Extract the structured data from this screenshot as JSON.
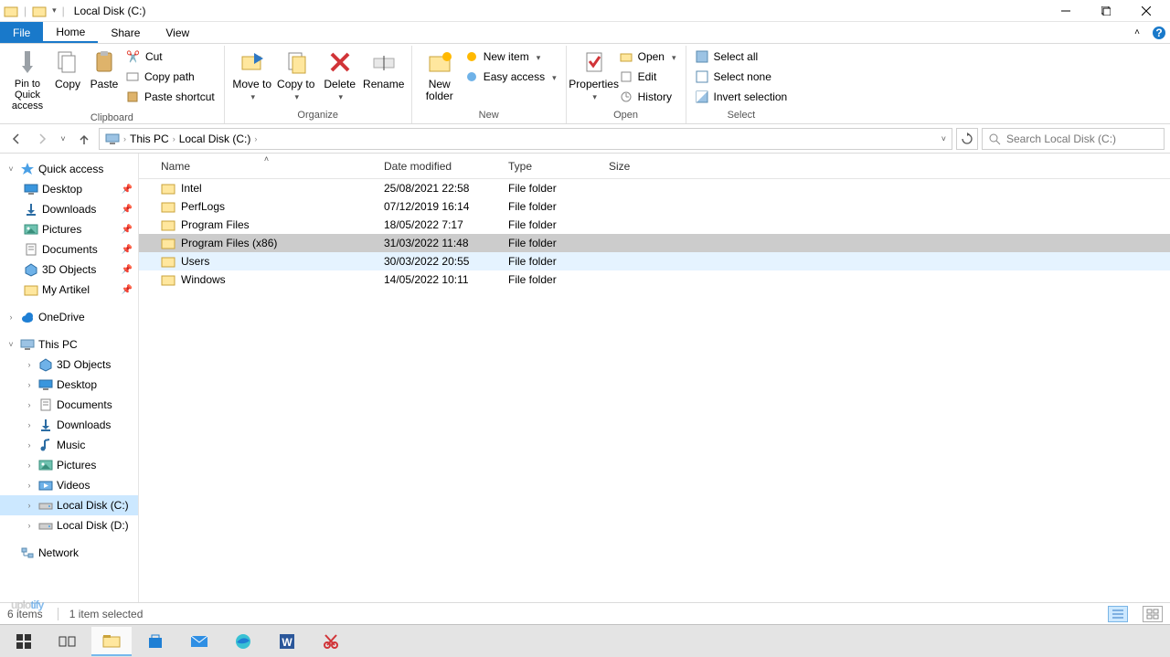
{
  "window": {
    "title": "Local Disk (C:)"
  },
  "tabs": {
    "file": "File",
    "home": "Home",
    "share": "Share",
    "view": "View"
  },
  "ribbon": {
    "clipboard": {
      "label": "Clipboard",
      "pin": "Pin to Quick access",
      "copy": "Copy",
      "paste": "Paste",
      "cut": "Cut",
      "copy_path": "Copy path",
      "paste_shortcut": "Paste shortcut"
    },
    "organize": {
      "label": "Organize",
      "move_to": "Move to",
      "copy_to": "Copy to",
      "delete": "Delete",
      "rename": "Rename"
    },
    "new": {
      "label": "New",
      "new_folder": "New folder",
      "new_item": "New item",
      "easy_access": "Easy access"
    },
    "open": {
      "label": "Open",
      "properties": "Properties",
      "open": "Open",
      "edit": "Edit",
      "history": "History"
    },
    "select": {
      "label": "Select",
      "select_all": "Select all",
      "select_none": "Select none",
      "invert": "Invert selection"
    }
  },
  "breadcrumb": {
    "this_pc": "This PC",
    "drive": "Local Disk (C:)"
  },
  "search": {
    "placeholder": "Search Local Disk (C:)"
  },
  "columns": {
    "name": "Name",
    "date": "Date modified",
    "type": "Type",
    "size": "Size"
  },
  "files": [
    {
      "name": "Intel",
      "date": "25/08/2021 22:58",
      "type": "File folder"
    },
    {
      "name": "PerfLogs",
      "date": "07/12/2019 16:14",
      "type": "File folder"
    },
    {
      "name": "Program Files",
      "date": "18/05/2022 7:17",
      "type": "File folder"
    },
    {
      "name": "Program Files (x86)",
      "date": "31/03/2022 11:48",
      "type": "File folder"
    },
    {
      "name": "Users",
      "date": "30/03/2022 20:55",
      "type": "File folder"
    },
    {
      "name": "Windows",
      "date": "14/05/2022 10:11",
      "type": "File folder"
    }
  ],
  "selected_index": 3,
  "hover_index": 4,
  "navpane": {
    "quick_access": "Quick access",
    "qa_items": [
      {
        "label": "Desktop",
        "icon": "desktop"
      },
      {
        "label": "Downloads",
        "icon": "downloads"
      },
      {
        "label": "Pictures",
        "icon": "pictures"
      },
      {
        "label": "Documents",
        "icon": "documents"
      },
      {
        "label": "3D Objects",
        "icon": "3d"
      },
      {
        "label": "My Artikel",
        "icon": "folder"
      }
    ],
    "onedrive": "OneDrive",
    "this_pc": "This PC",
    "pc_items": [
      {
        "label": "3D Objects",
        "icon": "3d"
      },
      {
        "label": "Desktop",
        "icon": "desktop"
      },
      {
        "label": "Documents",
        "icon": "documents"
      },
      {
        "label": "Downloads",
        "icon": "downloads"
      },
      {
        "label": "Music",
        "icon": "music"
      },
      {
        "label": "Pictures",
        "icon": "pictures"
      },
      {
        "label": "Videos",
        "icon": "videos"
      },
      {
        "label": "Local Disk (C:)",
        "icon": "drive"
      },
      {
        "label": "Local Disk (D:)",
        "icon": "drive"
      }
    ],
    "active_pc_index": 7,
    "network": "Network"
  },
  "status": {
    "items": "6 items",
    "selected": "1 item selected"
  },
  "watermark": {
    "a": "uplo",
    "b": "tify"
  }
}
